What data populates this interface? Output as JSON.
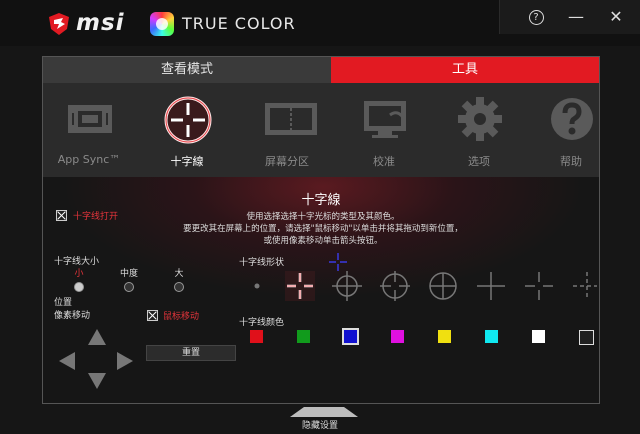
{
  "app": {
    "brand": "msi",
    "product": "TRUE COLOR"
  },
  "window": {
    "help": "?",
    "minimize": "—",
    "close": "✕"
  },
  "tabs": [
    {
      "label": "查看模式"
    },
    {
      "label": "工具"
    }
  ],
  "tools": [
    {
      "label": "App Sync™",
      "icon": "app-sync-icon"
    },
    {
      "label": "十字線",
      "icon": "crosshair-icon"
    },
    {
      "label": "屏幕分区",
      "icon": "screen-split-icon"
    },
    {
      "label": "校准",
      "icon": "calibration-icon"
    },
    {
      "label": "选项",
      "icon": "gear-icon"
    },
    {
      "label": "帮助",
      "icon": "help-icon"
    }
  ],
  "crosshair": {
    "title": "十字線",
    "desc": [
      "使用选择选择十字光标的类型及其颜色。",
      "要更改其在屏幕上的位置，请选择\"鼠标移动\"以单击并将其拖动到新位置，",
      "或使用像素移动单击箭头按钮。"
    ],
    "enable_label": "十字线打开",
    "size_label": "十字线大小",
    "sizes": [
      "小",
      "中度",
      "大"
    ],
    "position_label": "位置",
    "pixel_move_label": "像素移动",
    "mouse_move_label": "鼠标移动",
    "reset_label": "重置",
    "shape_label": "十字线形状",
    "color_label": "十字线颜色",
    "colors": [
      "#e0101a",
      "#119b1c",
      "#1111d0",
      "#e010e0",
      "#f0e010",
      "#10e8f0",
      "#ffffff",
      "#202020"
    ],
    "accent": "#e21a22"
  },
  "footer": {
    "hide_settings": "隐藏设置"
  }
}
